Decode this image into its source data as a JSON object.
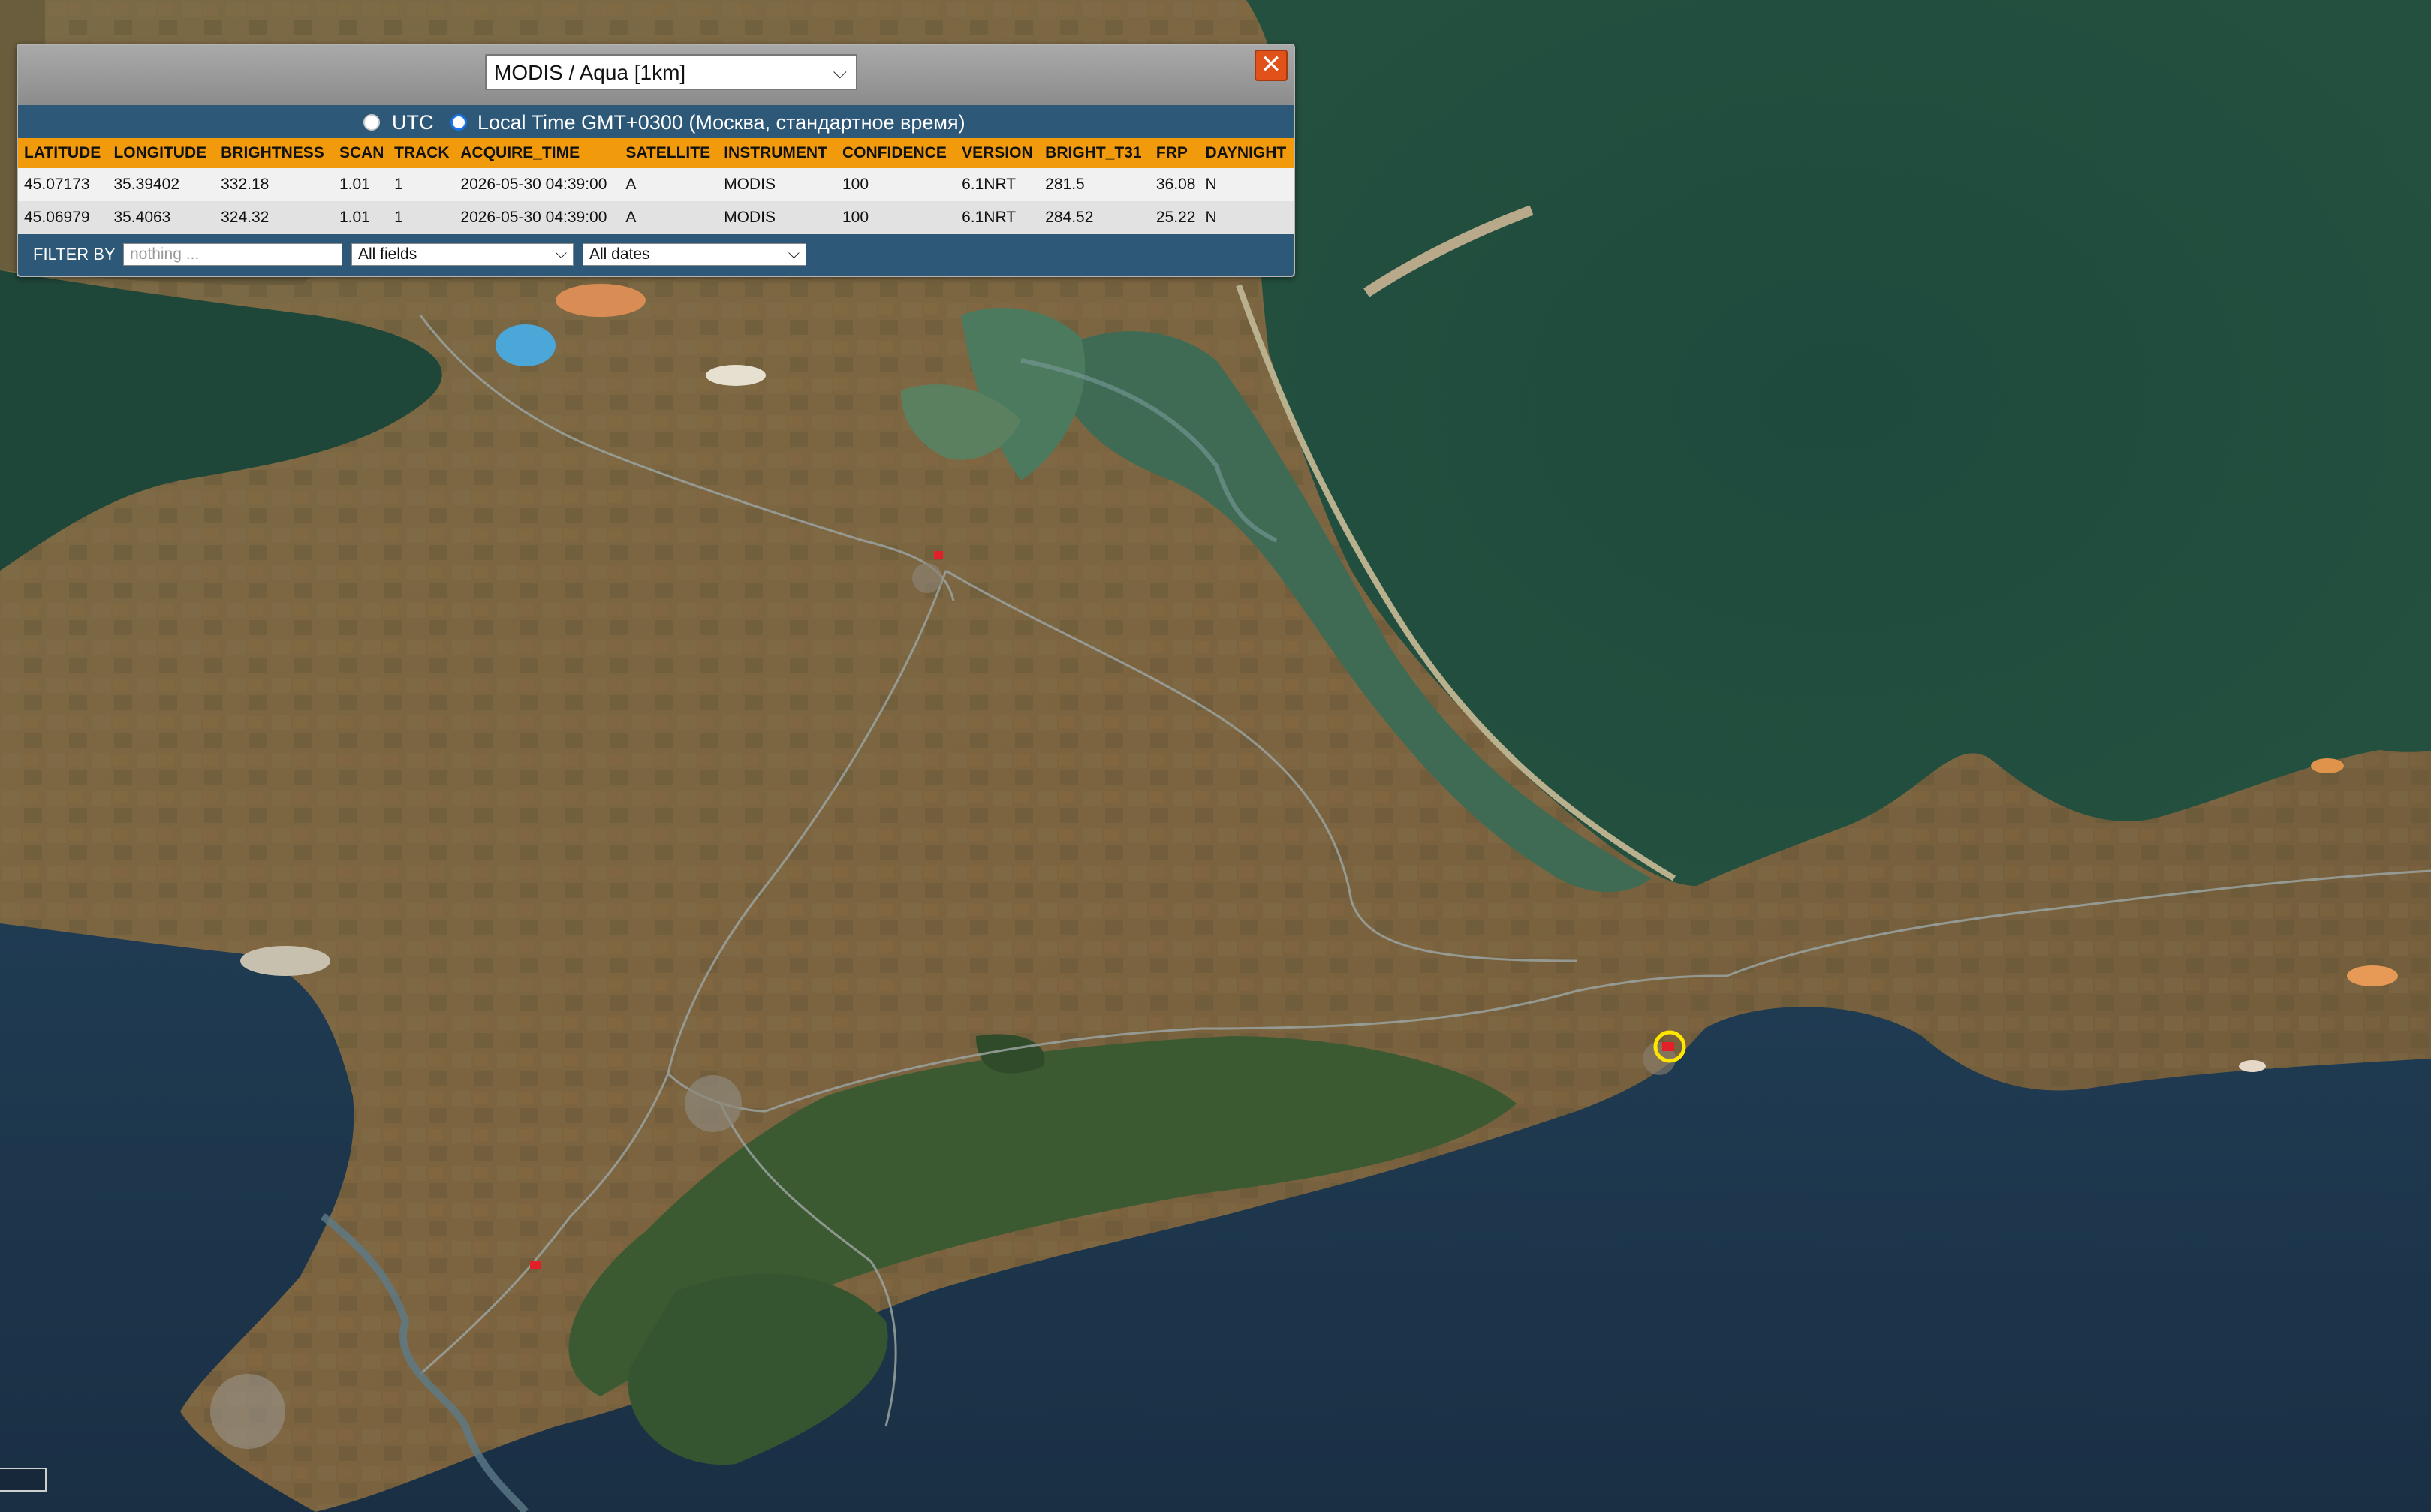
{
  "panel": {
    "source_select": "MODIS / Aqua [1km]",
    "close_glyph": "✕",
    "timezone": {
      "utc_label": "UTC",
      "local_label": "Local Time GMT+0300 (Москва, стандартное время)",
      "selected": "local"
    },
    "table": {
      "headers": [
        "LATITUDE",
        "LONGITUDE",
        "BRIGHTNESS",
        "SCAN",
        "TRACK",
        "ACQUIRE_TIME",
        "SATELLITE",
        "INSTRUMENT",
        "CONFIDENCE",
        "VERSION",
        "BRIGHT_T31",
        "FRP",
        "DAYNIGHT"
      ],
      "rows": [
        [
          "45.07173",
          "35.39402",
          "332.18",
          "1.01",
          "1",
          "2026-05-30 04:39:00",
          "A",
          "MODIS",
          "100",
          "6.1NRT",
          "281.5",
          "36.08",
          "N"
        ],
        [
          "45.06979",
          "35.4063",
          "324.32",
          "1.01",
          "1",
          "2026-05-30 04:39:00",
          "A",
          "MODIS",
          "100",
          "6.1NRT",
          "284.52",
          "25.22",
          "N"
        ]
      ]
    },
    "filter": {
      "label": "FILTER BY",
      "placeholder": "nothing ...",
      "field_select": "All fields",
      "date_select": "All dates"
    }
  },
  "map": {
    "marker_colors": {
      "fire": "#e3202a",
      "selected_ring": "#ffe600"
    },
    "icons": [
      "close-icon",
      "chevron-down-icon",
      "fire-marker-icon",
      "selected-fire-ring-icon"
    ]
  }
}
